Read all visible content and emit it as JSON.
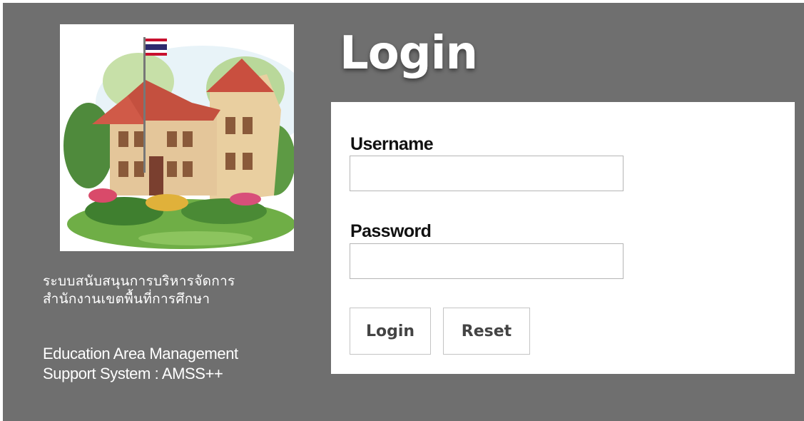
{
  "header": {
    "title": "Login"
  },
  "sidebar": {
    "illustration": "school-building-illustration",
    "description_th": [
      "ระบบสนับสนุนการบริหารจัดการ",
      "สำนักงานเขตพื้นที่การศึกษา"
    ],
    "description_en": [
      "Education Area Management",
      "Support System : AMSS++"
    ]
  },
  "form": {
    "username_label": "Username",
    "username_value": "",
    "password_label": "Password",
    "password_value": "",
    "login_button": "Login",
    "reset_button": "Reset"
  },
  "colors": {
    "background": "#6f6f6f",
    "panel": "#ffffff",
    "title_text": "#ffffff"
  }
}
